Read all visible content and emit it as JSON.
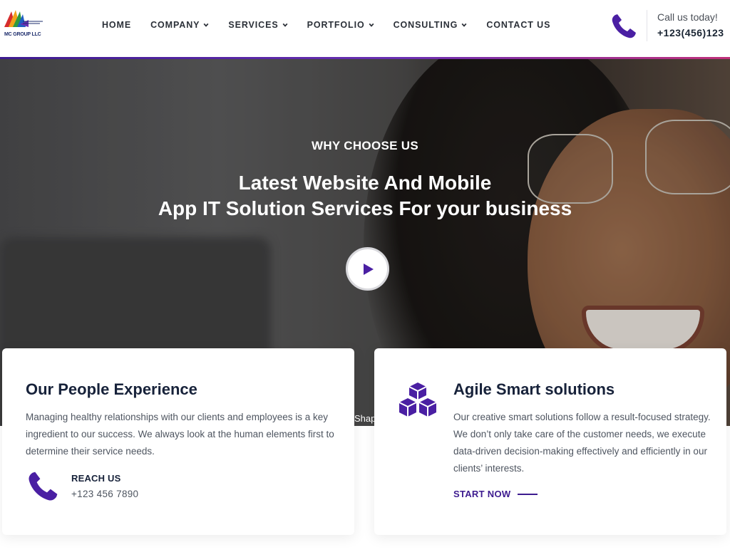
{
  "brand": {
    "logo_text": "MC GROUP LLC",
    "accent_color": "#4a1fa3"
  },
  "nav": {
    "items": [
      {
        "label": "HOME",
        "has_dropdown": false
      },
      {
        "label": "COMPANY",
        "has_dropdown": true
      },
      {
        "label": "SERVICES",
        "has_dropdown": true
      },
      {
        "label": "PORTFOLIO",
        "has_dropdown": true
      },
      {
        "label": "CONSULTING",
        "has_dropdown": true
      },
      {
        "label": "CONTACT US",
        "has_dropdown": false
      }
    ]
  },
  "header_contact": {
    "icon": "phone-icon",
    "label": "Call us today!",
    "number": "+123(456)123"
  },
  "hero": {
    "eyebrow": "WHY CHOOSE US",
    "title_line1": "Latest Website And Mobile",
    "title_line2": "App IT Solution Services For your business",
    "play_icon": "play-icon",
    "overflow_text": "Shap"
  },
  "cards": {
    "people": {
      "title": "Our People Experience",
      "body": "Managing healthy relationships with our clients and employees is a key ingredient to our success. We always look at the human elements first to determine their service needs.",
      "reach_icon": "phone-icon",
      "reach_label": "REACH US",
      "reach_phone": "+123 456 7890"
    },
    "agile": {
      "icon": "cubes-icon",
      "title": "Agile Smart solutions",
      "body": "Our creative smart solutions follow a result-focused strategy. We don’t only take care of the customer needs, we execute data-driven decision-making effectively and efficiently in our clients’ interests.",
      "link_label": "START NOW"
    }
  }
}
